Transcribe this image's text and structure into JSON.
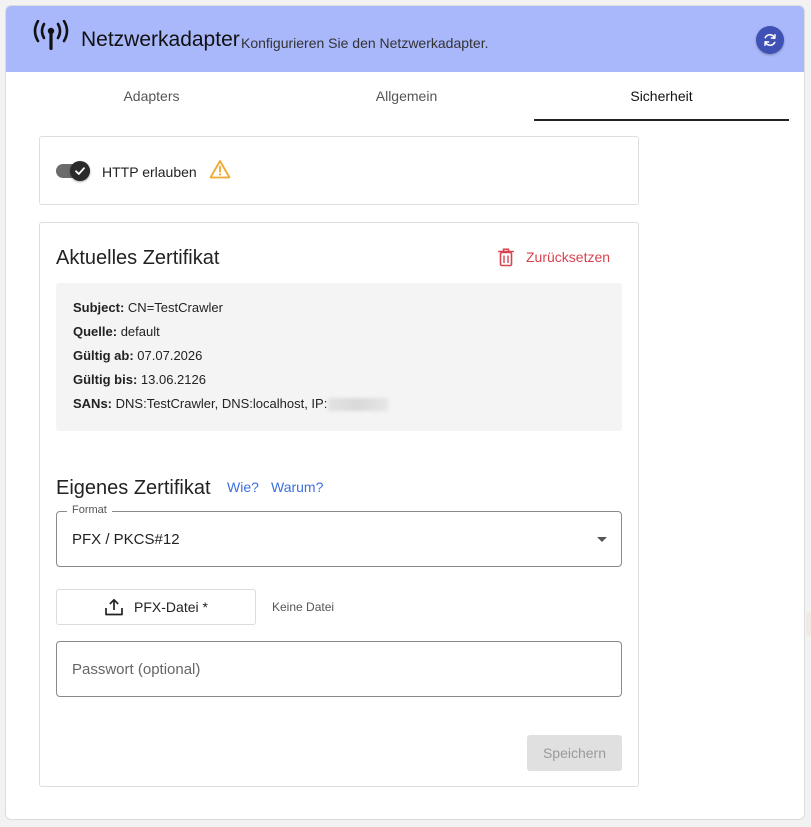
{
  "header": {
    "title": "Netzwerkadapter",
    "subtitle": "Konfigurieren Sie den Netzwerkadapter.",
    "app_icon": "antenna-icon",
    "refresh_icon": "refresh-icon",
    "colors": {
      "header_bg": "#a9b7fb",
      "refresh_bg": "#3f51b5"
    }
  },
  "tabs": [
    {
      "label": "Adapters",
      "active": false
    },
    {
      "label": "Allgemein",
      "active": false
    },
    {
      "label": "Sicherheit",
      "active": true
    }
  ],
  "http": {
    "toggle_on": true,
    "label": "HTTP erlauben",
    "warning_icon": "warning-icon",
    "warning_color": "#f0a830"
  },
  "current_cert": {
    "title": "Aktuelles Zertifikat",
    "reset_label": "Zurücksetzen",
    "reset_icon": "trash-icon",
    "reset_color": "#d84350",
    "rows": [
      {
        "key": "Subject:",
        "value": "CN=TestCrawler"
      },
      {
        "key": "Quelle:",
        "value": "default"
      },
      {
        "key": "Gültig ab:",
        "value": "07.07.2026"
      },
      {
        "key": "Gültig bis:",
        "value": "13.06.2126"
      },
      {
        "key": "SANs:",
        "value": "DNS:TestCrawler, DNS:localhost, IP:"
      }
    ]
  },
  "own_cert": {
    "title": "Eigenes Zertifikat",
    "link_how": "Wie?",
    "link_why": "Warum?",
    "format_label": "Format",
    "format_value": "PFX / PKCS#12",
    "file_button_label": "PFX-Datei *",
    "file_icon": "upload-icon",
    "file_status": "Keine Datei",
    "password_placeholder": "Passwort (optional)",
    "password_value": "",
    "save_label": "Speichern"
  }
}
